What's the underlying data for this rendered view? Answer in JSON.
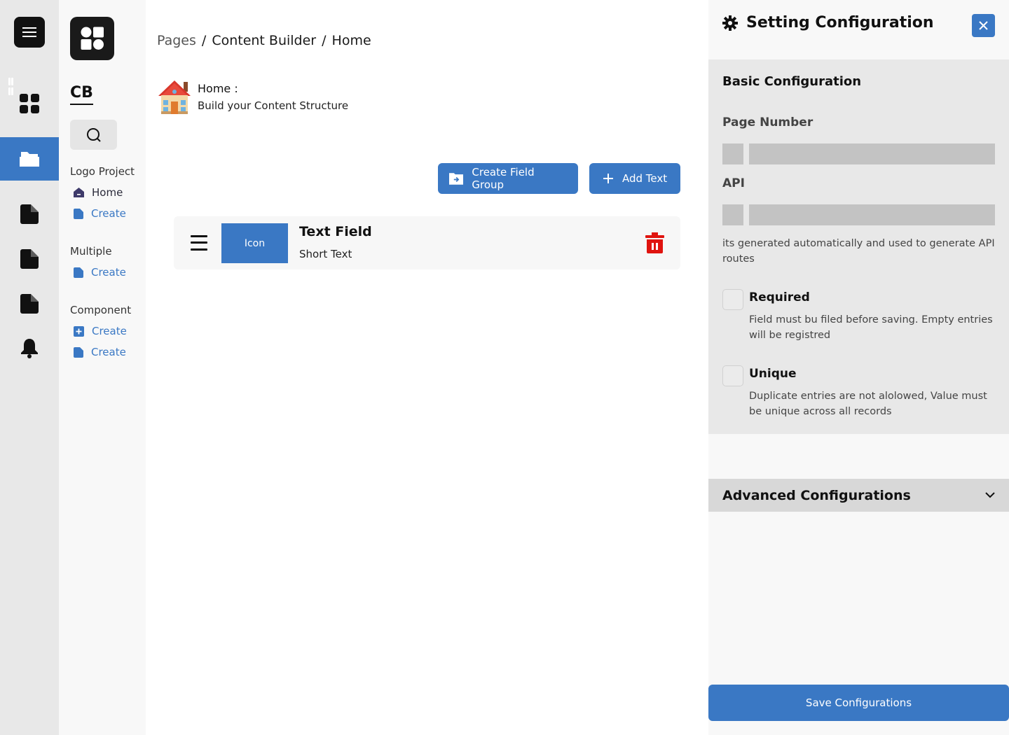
{
  "rail": {
    "icons": [
      "menu-icon",
      "dashboard-icon",
      "folder-icon",
      "page-icon",
      "page-icon",
      "page-icon",
      "bell-icon"
    ],
    "active_color": "#3a78c4"
  },
  "sidebar": {
    "brand": "CB",
    "sections": [
      {
        "title": "Logo Project",
        "items": [
          {
            "label": "Home",
            "icon": "home-icon"
          },
          {
            "label": "Create",
            "icon": "page-icon"
          }
        ]
      },
      {
        "title": "Multiple",
        "items": [
          {
            "label": "Create",
            "icon": "page-icon"
          }
        ]
      },
      {
        "title": "Component",
        "items": [
          {
            "label": "Create",
            "icon": "add-box-icon"
          },
          {
            "label": "Create",
            "icon": "page-icon"
          }
        ]
      }
    ]
  },
  "breadcrumb": {
    "items": [
      "Pages",
      "Content Builder",
      "Home"
    ],
    "separator": "/"
  },
  "page": {
    "title": "Home :",
    "subtitle": "Build your Content Structure"
  },
  "actions": {
    "create_group": "Create Field Group",
    "add_text": "Add Text"
  },
  "field": {
    "icon_label": "Icon",
    "title": "Text Field",
    "subtitle": "Short Text"
  },
  "settings": {
    "title": "Setting Configuration",
    "basic": {
      "title": "Basic Configuration",
      "page_number_label": "Page Number",
      "api_label": "API",
      "api_hint": "its generated automatically and used to generate API routes",
      "required_label": "Required",
      "required_desc": "Field must bu filed before saving. Empty entries will be registred",
      "unique_label": "Unique",
      "unique_desc": "Duplicate entries are not alolowed, Value must be unique across all records"
    },
    "advanced_label": "Advanced Configurations",
    "save_label": "Save Configurations"
  },
  "colors": {
    "accent": "#3a78c4",
    "danger": "#e0140f",
    "dark": "#111111"
  }
}
